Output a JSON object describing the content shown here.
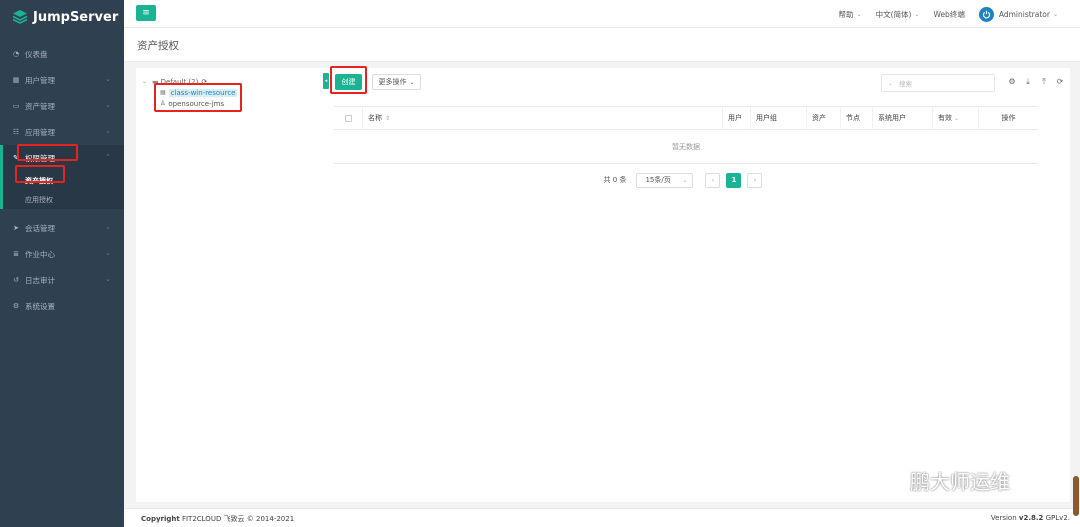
{
  "app": {
    "brand": "JumpServer"
  },
  "colors": {
    "accent": "#1ab394",
    "sidebar": "#2f4050",
    "highlight": "#e6231f"
  },
  "sidebar": {
    "items": [
      {
        "icon": "dashboard-icon",
        "label": "仪表盘"
      },
      {
        "icon": "users-icon",
        "label": "用户管理"
      },
      {
        "icon": "assets-icon",
        "label": "资产管理"
      },
      {
        "icon": "apps-icon",
        "label": "应用管理"
      },
      {
        "icon": "perms-icon",
        "label": "权限管理"
      },
      {
        "icon": "session-icon",
        "label": "会话管理"
      },
      {
        "icon": "jobs-icon",
        "label": "作业中心"
      },
      {
        "icon": "audit-icon",
        "label": "日志审计"
      },
      {
        "icon": "settings-icon",
        "label": "系统设置"
      }
    ],
    "submenu": [
      {
        "label": "资产授权"
      },
      {
        "label": "应用授权"
      }
    ]
  },
  "topbar": {
    "help": "帮助",
    "language": "中文(简体)",
    "web_terminal": "Web终端",
    "user": "Administrator"
  },
  "page": {
    "title": "资产授权"
  },
  "tree": {
    "root": "Default (2)",
    "children": [
      {
        "icon": "windows-icon",
        "label": "class-win-resource"
      },
      {
        "icon": "linux-icon",
        "label": "opensource-jms"
      }
    ]
  },
  "toolbar": {
    "create": "创建",
    "more": "更多操作",
    "search_placeholder": "搜索"
  },
  "table": {
    "columns": [
      "名称",
      "用户",
      "用户组",
      "资产",
      "节点",
      "系统用户",
      "有效",
      "操作"
    ],
    "empty": "暂无数据"
  },
  "pager": {
    "total": "共 0 条",
    "page_size": "15条/页",
    "current": "1"
  },
  "footer": {
    "copyright_label": "Copyright",
    "copyright": "FIT2CLOUD 飞致云 © 2014-2021",
    "version_label": "Version",
    "version": "v2.8.2",
    "license": "GPLv2."
  },
  "watermark": "鹏大师运维"
}
